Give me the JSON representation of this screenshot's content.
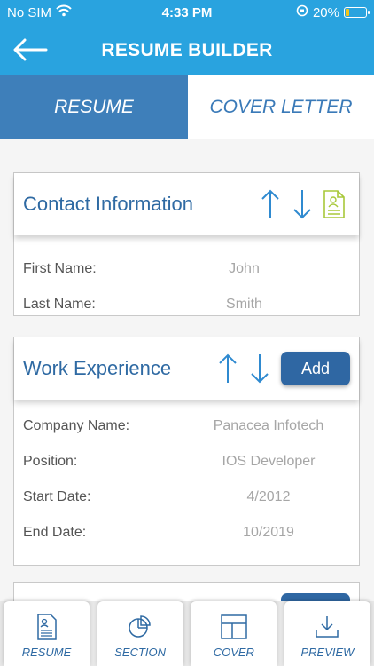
{
  "status": {
    "carrier": "No SIM",
    "time": "4:33 PM",
    "battery": "20%",
    "battery_level": 0.2
  },
  "header": {
    "title": "RESUME BUILDER"
  },
  "tabs": [
    {
      "label": "RESUME"
    },
    {
      "label": "COVER LETTER"
    }
  ],
  "contact": {
    "title": "Contact Information",
    "fields": [
      {
        "label": "First Name:",
        "value": "John"
      },
      {
        "label": "Last Name:",
        "value": "Smith"
      }
    ]
  },
  "work": {
    "title": "Work Experience",
    "add_label": "Add",
    "fields": [
      {
        "label": "Company Name:",
        "value": "Panacea Infotech"
      },
      {
        "label": "Position:",
        "value": "IOS Developer"
      },
      {
        "label": "Start Date:",
        "value": "4/2012"
      },
      {
        "label": "End Date:",
        "value": "10/2019"
      }
    ]
  },
  "bottom_nav": [
    {
      "label": "RESUME",
      "icon": "resume-doc-icon"
    },
    {
      "label": "SECTION",
      "icon": "pie-chart-icon"
    },
    {
      "label": "COVER",
      "icon": "grid-layout-icon"
    },
    {
      "label": "PREVIEW",
      "icon": "download-icon"
    }
  ],
  "colors": {
    "header": "#29a3df",
    "active_tab": "#3e7fba",
    "accent": "#2f6aa3",
    "doc_icon": "#a8c83a"
  }
}
